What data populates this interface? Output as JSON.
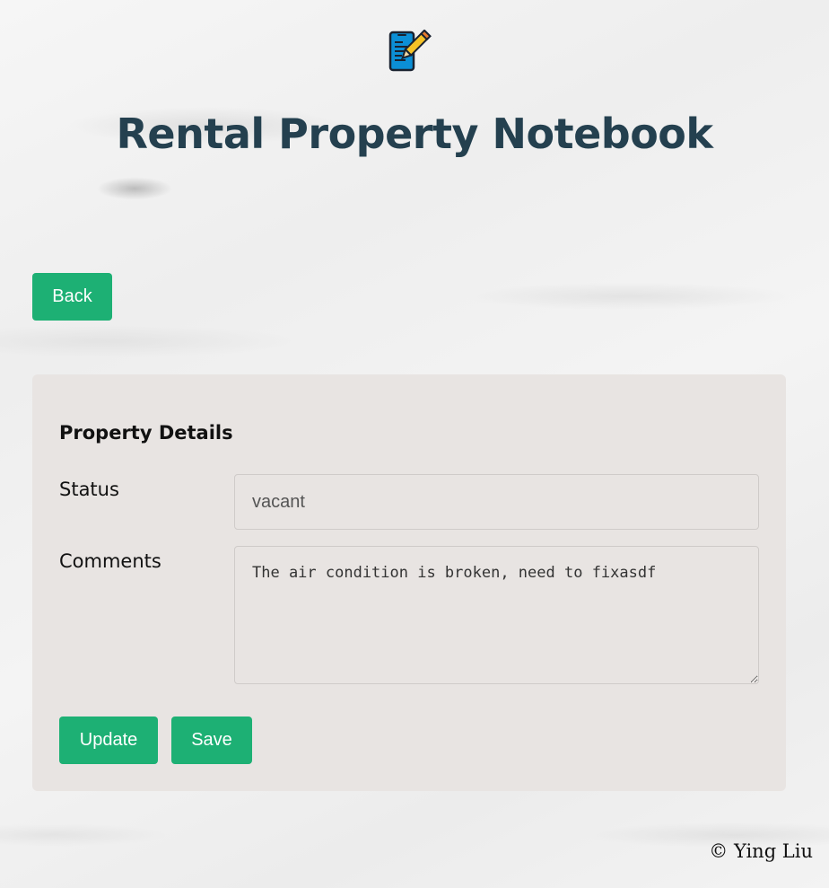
{
  "header": {
    "logo_icon": "phone-notebook-pencil-icon",
    "title": "Rental Property Notebook"
  },
  "nav": {
    "back_label": "Back"
  },
  "details": {
    "title": "Property Details",
    "status_label": "Status",
    "status_value": "vacant",
    "comments_label": "Comments",
    "comments_value": "The air condition is broken, need to fixasdf",
    "update_label": "Update",
    "save_label": "Save"
  },
  "footer": {
    "copyright": "© Ying Liu"
  },
  "colors": {
    "accent": "#1db074",
    "title": "#24404f",
    "card_background": "#e8e4e2"
  }
}
